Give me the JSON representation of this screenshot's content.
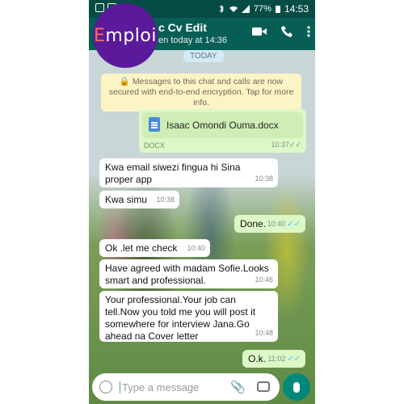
{
  "status": {
    "battery": "77%",
    "time": "14:53"
  },
  "header": {
    "title": "c Cv Edit",
    "subtitle": "en today at 14:36"
  },
  "logo": {
    "prefix": "E",
    "rest": "mploi"
  },
  "date_chip": "TODAY",
  "encryption_notice": "🔒 Messages to this chat and calls are now secured with end-to-end encryption. Tap for more info.",
  "attachment": {
    "file_name": "Isaac Omondi Ouma.docx",
    "file_type": "DOCX",
    "time": "10:37"
  },
  "messages": [
    {
      "text": "Kwa email siwezi fingua hi Sina proper app",
      "time": "10:38",
      "outgoing": false
    },
    {
      "text": "Kwa simu",
      "time": "10:38",
      "outgoing": false
    },
    {
      "text": "Done.",
      "time": "10:40",
      "outgoing": true
    },
    {
      "text": "Ok .let me check",
      "time": "10:40",
      "outgoing": false
    },
    {
      "text": "Have agreed with madam Sofie.Looks smart and professional.",
      "time": "10:46",
      "outgoing": false
    },
    {
      "text": "Your professional.Your job can tell.Now you told me you will post it somewhere for interview Jana.Go ahead na Cover letter",
      "time": "10:48",
      "outgoing": false
    },
    {
      "text": "O.k.",
      "time": "11:02",
      "outgoing": true
    }
  ],
  "composer": {
    "placeholder": "Type a message"
  },
  "colors": {
    "header": "#075e54",
    "outgoing_bubble": "#dcf8c6",
    "accent": "#00897b"
  }
}
